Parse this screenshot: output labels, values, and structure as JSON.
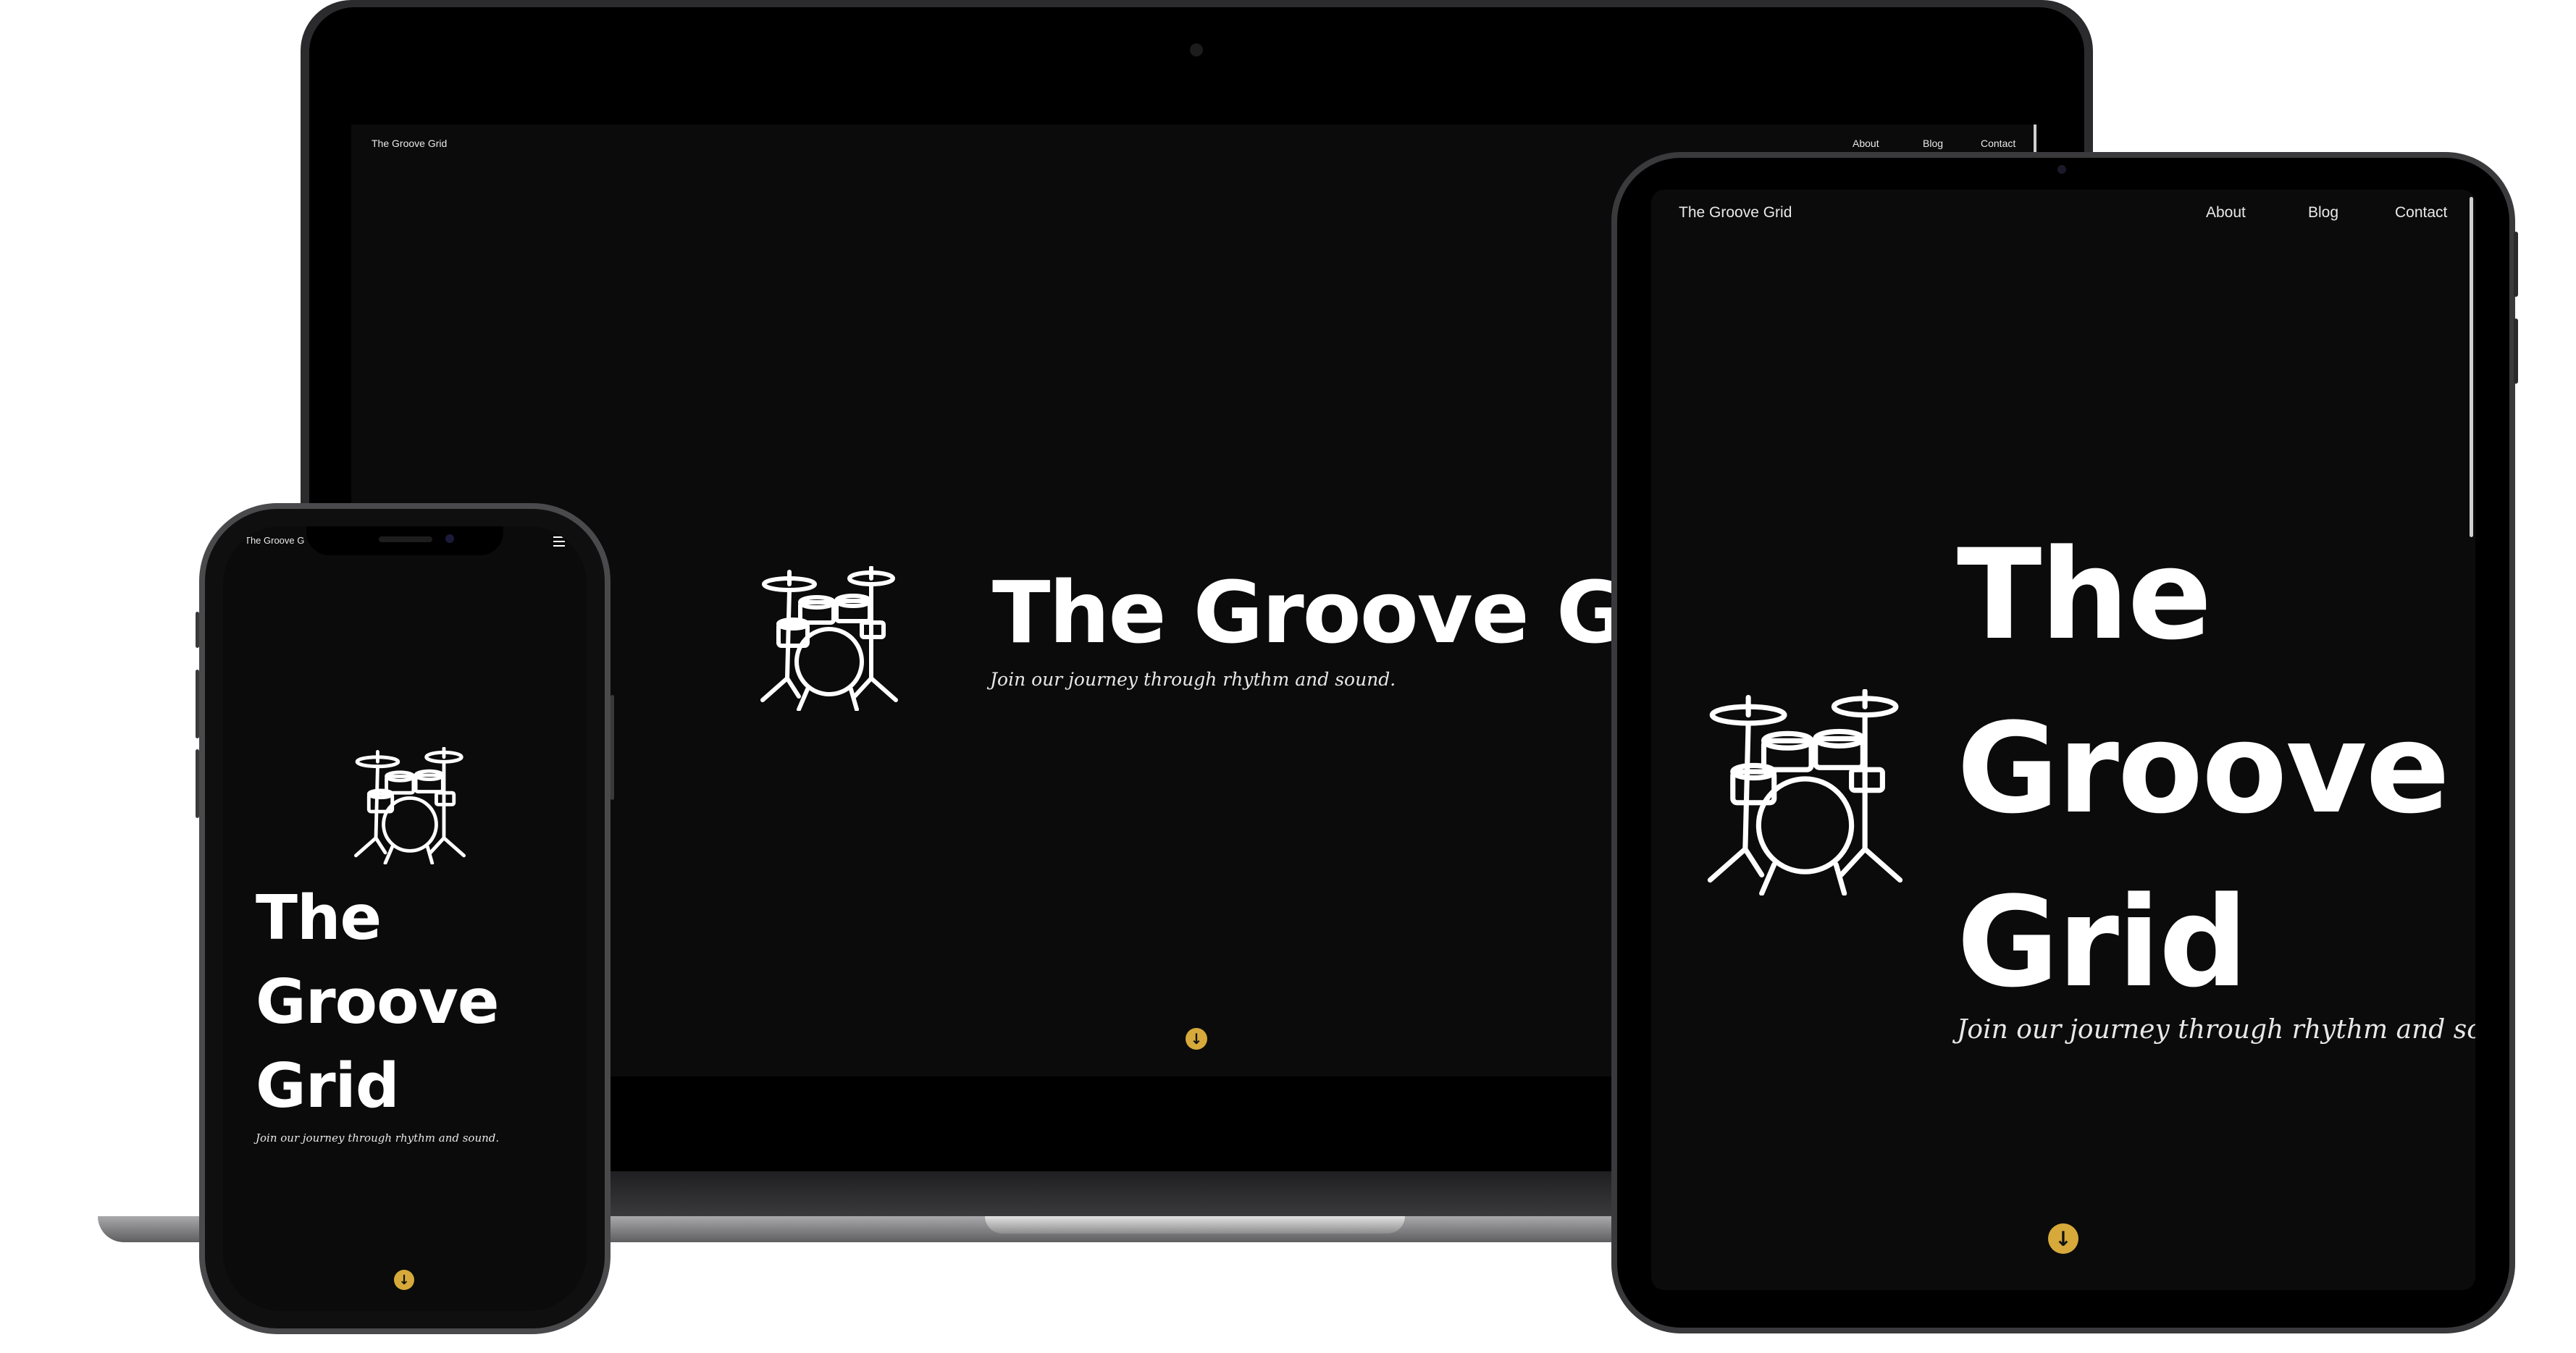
{
  "site": {
    "brand": "The Groove Grid",
    "nav": [
      "About",
      "Blog",
      "Contact"
    ],
    "title": "The Groove Grid",
    "title_lines": [
      "The",
      "Groove",
      "Grid"
    ],
    "tagline": "Join our journey through rhythm and sound.",
    "brand_truncated": "The Groove G"
  },
  "icons": {
    "hero": "drum-kit-icon",
    "scroll": "arrow-down-circle-icon",
    "menu": "hamburger-menu-icon"
  },
  "colors": {
    "page_bg": "#0b0b0b",
    "accent": "#d6a93a",
    "text": "#ffffff"
  }
}
